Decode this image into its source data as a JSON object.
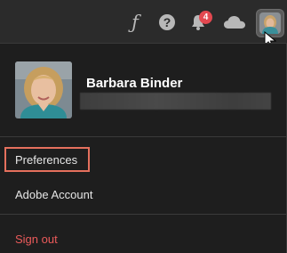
{
  "header": {
    "notification_count": "4",
    "icons": [
      "font-icon",
      "help-icon",
      "bell-icon",
      "cloud-icon",
      "avatar"
    ]
  },
  "profile": {
    "name": "Barbara Binder"
  },
  "menu": {
    "preferences_label": "Preferences",
    "adobe_account_label": "Adobe Account",
    "sign_out_label": "Sign out"
  },
  "colors": {
    "highlight": "#e5705d",
    "sign_out": "#ea5a5a",
    "badge": "#e34850"
  }
}
